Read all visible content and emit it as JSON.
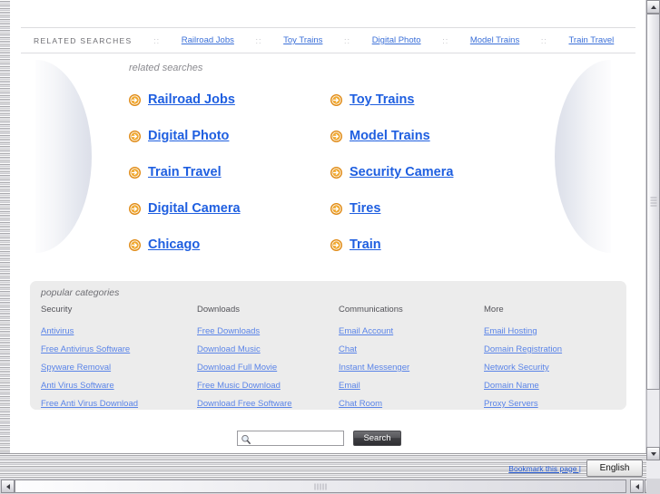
{
  "top_strip": {
    "label": "RELATED SEARCHES",
    "separator": "::",
    "links": [
      "Railroad Jobs",
      "Toy Trains",
      "Digital Photo",
      "Model Trains",
      "Train Travel"
    ]
  },
  "related_searches": {
    "heading": "related searches",
    "icon": "circle-arrow-right-icon",
    "links": [
      "Railroad Jobs",
      "Toy Trains",
      "Digital Photo",
      "Model Trains",
      "Train Travel",
      "Security Camera",
      "Digital Camera",
      "Tires",
      "Chicago",
      "Train"
    ]
  },
  "popular_categories": {
    "heading": "popular categories",
    "columns": [
      {
        "title": "Security",
        "links": [
          "Antivirus",
          "Free Antivirus Software",
          "Spyware Removal",
          "Anti Virus Software",
          "Free Anti Virus Download"
        ]
      },
      {
        "title": "Downloads",
        "links": [
          "Free Downloads",
          "Download Music",
          "Download Full Movie",
          "Free Music Download",
          "Download Free Software"
        ]
      },
      {
        "title": "Communications",
        "links": [
          "Email Account",
          "Chat",
          "Instant Messenger",
          "Email",
          "Chat Room"
        ]
      },
      {
        "title": "More",
        "links": [
          "Email Hosting",
          "Domain Registration",
          "Network Security",
          "Domain Name",
          "Proxy Servers"
        ]
      }
    ]
  },
  "search": {
    "value": "",
    "placeholder": "",
    "icon": "magnifier-icon",
    "button_label": "Search"
  },
  "status_bar": {
    "bookmark_label": "Bookmark this page |",
    "language": "English",
    "language_options": [
      "English"
    ]
  },
  "colors": {
    "big_link": "#1f5fe0",
    "small_link": "#5a84e8",
    "top_link": "#3a6fd8",
    "arrow_icon": "#e08a14",
    "panel_bg": "#ececec",
    "heading_text": "#8b8b90"
  }
}
